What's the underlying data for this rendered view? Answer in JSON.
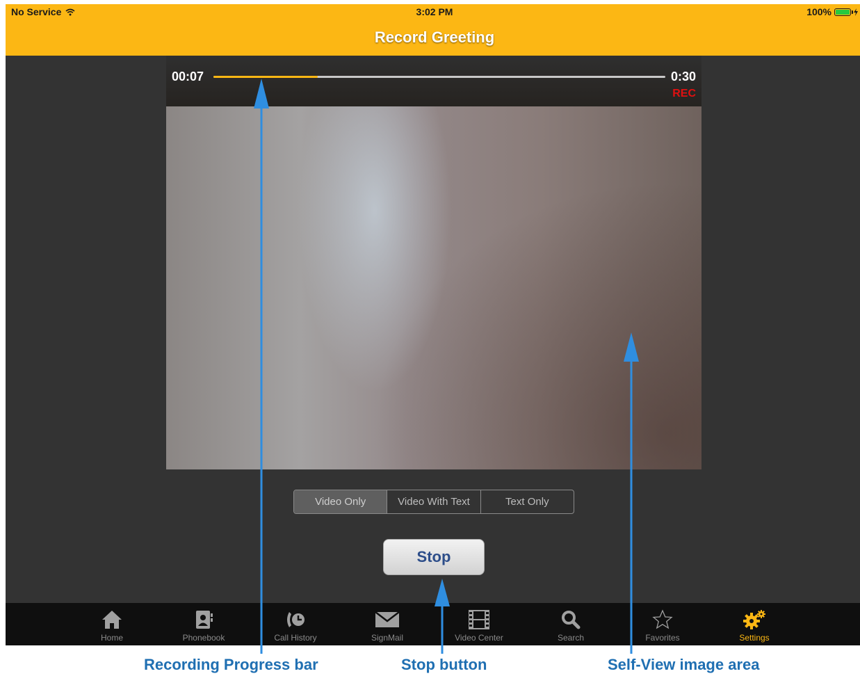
{
  "status_bar": {
    "carrier": "No Service",
    "time": "3:02 PM",
    "battery": "100%"
  },
  "title": "Record Greeting",
  "recording": {
    "elapsed": "00:07",
    "total": "0:30",
    "indicator": "REC",
    "progress_fraction": 0.23
  },
  "mode_options": [
    {
      "label": "Video Only",
      "selected": true
    },
    {
      "label": "Video With Text",
      "selected": false
    },
    {
      "label": "Text Only",
      "selected": false
    }
  ],
  "stop_label": "Stop",
  "tabs": [
    {
      "label": "Home",
      "icon": "home-icon",
      "active": false
    },
    {
      "label": "Phonebook",
      "icon": "phonebook-icon",
      "active": false
    },
    {
      "label": "Call History",
      "icon": "call-history-icon",
      "active": false
    },
    {
      "label": "SignMail",
      "icon": "envelope-icon",
      "active": false
    },
    {
      "label": "Video Center",
      "icon": "film-icon",
      "active": false
    },
    {
      "label": "Search",
      "icon": "search-icon",
      "active": false
    },
    {
      "label": "Favorites",
      "icon": "star-icon",
      "active": false
    },
    {
      "label": "Settings",
      "icon": "gears-icon",
      "active": true
    }
  ],
  "annotations": {
    "progress": "Recording Progress bar",
    "stop": "Stop button",
    "selfview": "Self-View image area"
  },
  "colors": {
    "accent": "#fcb714",
    "rec": "#e01010",
    "callout": "#1f6fb2",
    "stop_text": "#2d4e8a"
  }
}
